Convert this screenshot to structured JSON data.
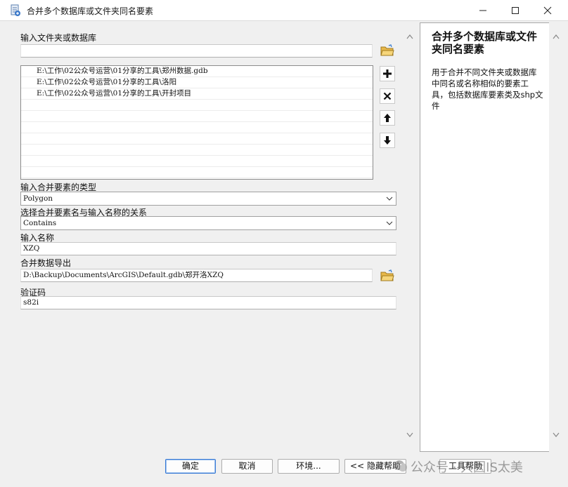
{
  "window": {
    "title": "合并多个数据库或文件夹同名要素",
    "min_icon": "minimize-icon",
    "max_icon": "maximize-icon",
    "close_icon": "close-icon"
  },
  "form": {
    "input_folder_label": "输入文件夹或数据库",
    "input_folder_value": "",
    "list_items": [
      "E:\\工作\\02公众号运营\\01分享的工具\\郑州数据.gdb",
      "E:\\工作\\02公众号运营\\01分享的工具\\洛阳",
      "E:\\工作\\02公众号运营\\01分享的工具\\开封项目"
    ],
    "type_label": "输入合并要素的类型",
    "type_value": "Polygon",
    "relation_label": "选择合并要素名与输入名称的关系",
    "relation_value": "Contains",
    "name_label": "输入名称",
    "name_value": "XZQ",
    "output_label": "合并数据导出",
    "output_value": "D:\\Backup\\Documents\\ArcGIS\\Default.gdb\\郑开洛XZQ",
    "code_label": "验证码",
    "code_value": "s82i"
  },
  "help": {
    "title": "合并多个数据库或文件夹同名要素",
    "description": "用于合并不同文件夹或数据库中同名或名称相似的要素工具，包括数据库要素类及shp文件"
  },
  "buttons": {
    "ok": "确定",
    "cancel": "取消",
    "env": "环境...",
    "hide_help": "<< 隐藏帮助",
    "tool_help": "工具帮助"
  },
  "watermark": {
    "text": "公众号 · 只因IS太美"
  }
}
